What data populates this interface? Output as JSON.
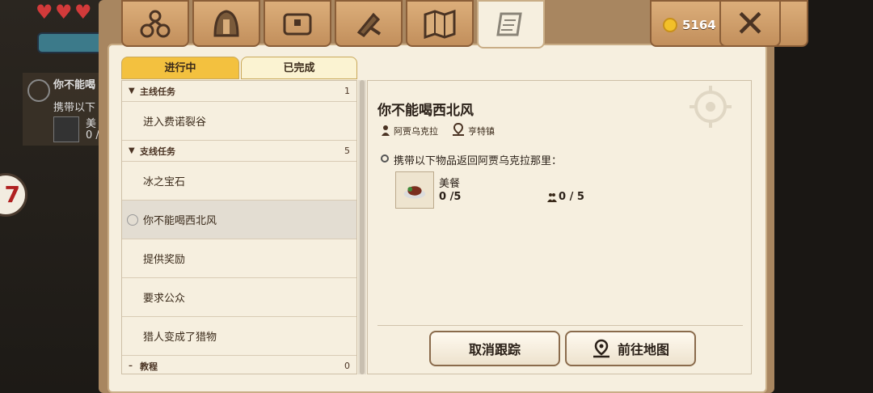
{
  "hud": {
    "quest_title": "你不能喝",
    "quest_desc": "携带以下",
    "item_name": "美",
    "item_count": "0 /",
    "level": "7"
  },
  "tabs": [
    {
      "icon": "rocks-icon"
    },
    {
      "icon": "helmet-icon"
    },
    {
      "icon": "chest-icon"
    },
    {
      "icon": "crafting-icon"
    },
    {
      "icon": "map-icon"
    },
    {
      "icon": "scroll-icon"
    }
  ],
  "currency": {
    "value": "5164"
  },
  "close_label": "✕",
  "subtabs": {
    "active": "进行中",
    "done": "已完成"
  },
  "list": {
    "main_cat": {
      "label": "主线任务",
      "count": "1"
    },
    "main_items": [
      "进入费诺裂谷"
    ],
    "side_cat": {
      "label": "支线任务",
      "count": "5"
    },
    "side_items": [
      "冰之宝石",
      "你不能喝西北风",
      "提供奖励",
      "要求公众",
      "猎人变成了猎物"
    ],
    "tut_cat": {
      "label": "教程",
      "count": "0"
    }
  },
  "detail": {
    "title": "你不能喝西北风",
    "npc": "阿贾乌克拉",
    "location": "亨特镇",
    "objective": "携带以下物品返回阿贾乌克拉那里：",
    "item_name": "美餐",
    "item_count": "0 /5",
    "team_count": "0 / 5",
    "cancel_btn": "取消跟踪",
    "map_btn": "前往地图"
  },
  "colors": {
    "accent": "#f3c13f",
    "paper": "#f6efdf",
    "wood": "#c28f5c"
  }
}
